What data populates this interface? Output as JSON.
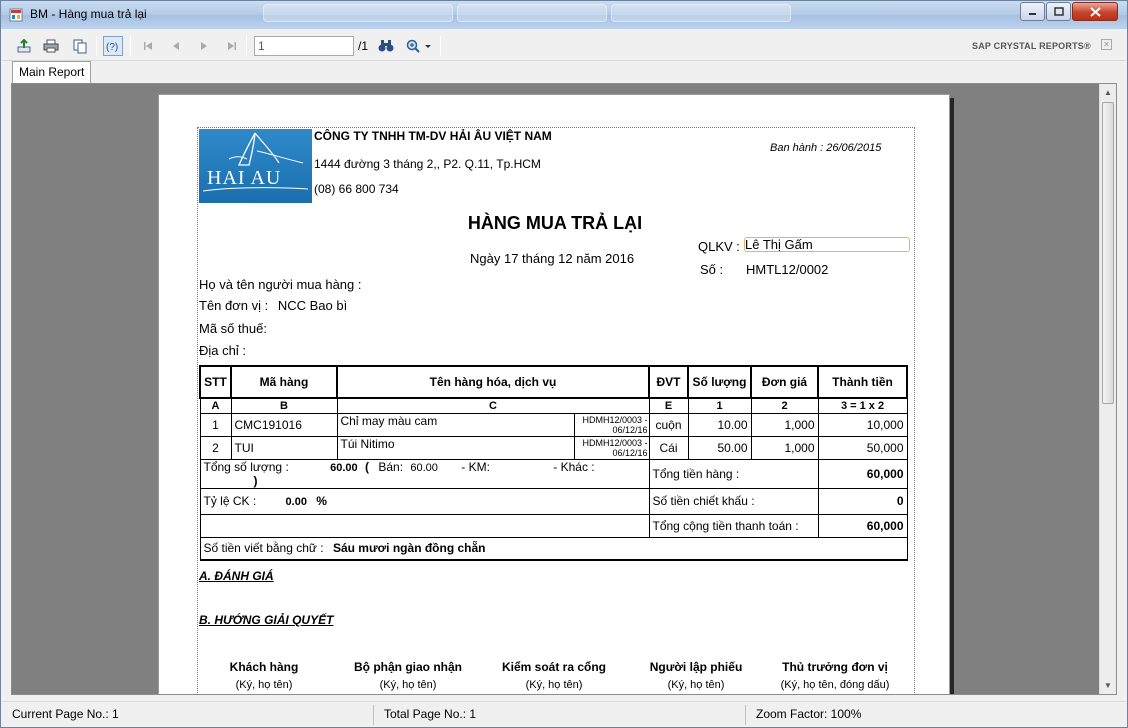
{
  "window": {
    "title": "BM - Hàng mua trả lại"
  },
  "toolbar": {
    "page_value": "1",
    "page_total": "/1",
    "brand": "SAP CRYSTAL REPORTS®"
  },
  "tabs": [
    "Main Report"
  ],
  "report": {
    "company_name": "CÔNG TY TNHH TM-DV HẢI ÂU VIỆT NAM",
    "company_address": "1444 đường 3 tháng 2,, P2. Q.11, Tp.HCM",
    "company_phone": "(08) 66 800 734",
    "issued": "Ban hành : 26/06/2015",
    "logo_text": "HAI AU",
    "title": "HÀNG MUA TRẢ LẠI",
    "date": "Ngày 17 tháng 12 năm 2016",
    "qlkv_label": "QLKV :",
    "qlkv_value": "Lê Thị Gấm",
    "so_label": "Số :",
    "so_value": "HMTL12/0002",
    "buyer_label": "Họ và tên người mua hàng :",
    "unit_label": "Tên đơn vị :",
    "unit_value": "NCC Bao bì",
    "tax_label": "Mã số thuế:",
    "address_label": "Địa chỉ :",
    "table": {
      "headers": [
        "STT",
        "Mã hàng",
        "Tên hàng hóa, dịch vụ",
        "ĐVT",
        "Số lượng",
        "Đơn giá",
        "Thành tiền"
      ],
      "codes": [
        "A",
        "B",
        "C",
        "E",
        "1",
        "2",
        "3 = 1 x 2"
      ],
      "rows": [
        {
          "stt": "1",
          "code": "CMC191016",
          "name": "Chỉ may màu cam",
          "ref": "HDMH12/0003 - 06/12/16",
          "unit": "cuộn",
          "qty": "10.00",
          "price": "1,000",
          "amount": "10,000"
        },
        {
          "stt": "2",
          "code": "TUI",
          "name": "Túi Nitimo",
          "ref": "HDMH12/0003 - 06/12/16",
          "unit": "Cái",
          "qty": "50.00",
          "price": "1,000",
          "amount": "50,000"
        }
      ],
      "total_qty_label": "Tổng số lượng :",
      "total_qty_value": "60.00",
      "open_paren": "(",
      "ban_label": "Bán:",
      "ban_value": "60.00",
      "km_label": "- KM:",
      "khac_label": "- Khác :",
      "close_paren": ")",
      "goods_total_label": "Tổng tiền hàng :",
      "goods_total_value": "60,000",
      "discount_rate_label": "Tỷ lệ CK :",
      "discount_rate_value": "0.00",
      "percent": "%",
      "discount_amount_label": "Số tiền chiết khấu :",
      "discount_amount_value": "0",
      "grand_total_label": "Tổng cộng tiền thanh toán :",
      "grand_total_value": "60,000",
      "words_label": "Số tiền viết bằng chữ :",
      "words_value": "Sáu mươi ngàn đồng chẵn"
    },
    "section_a": "A. ĐÁNH GIÁ",
    "section_b": "B. HƯỚNG GIẢI QUYẾT",
    "signatures": [
      {
        "role": "Khách hàng",
        "note": "(Ký, họ tên)"
      },
      {
        "role": "Bộ phận giao nhận",
        "note": "(Ký, họ tên)"
      },
      {
        "role": "Kiểm soát ra cổng",
        "note": "(Ký, họ tên)"
      },
      {
        "role": "Người lập phiếu",
        "note": "(Ký, họ tên)"
      },
      {
        "role": "Thủ trưởng đơn vị",
        "note": "(Ký, họ tên, đóng dấu)"
      }
    ]
  },
  "status": {
    "current_page": "Current Page No.: 1",
    "total_page": "Total Page No.: 1",
    "zoom": "Zoom Factor: 100%"
  }
}
